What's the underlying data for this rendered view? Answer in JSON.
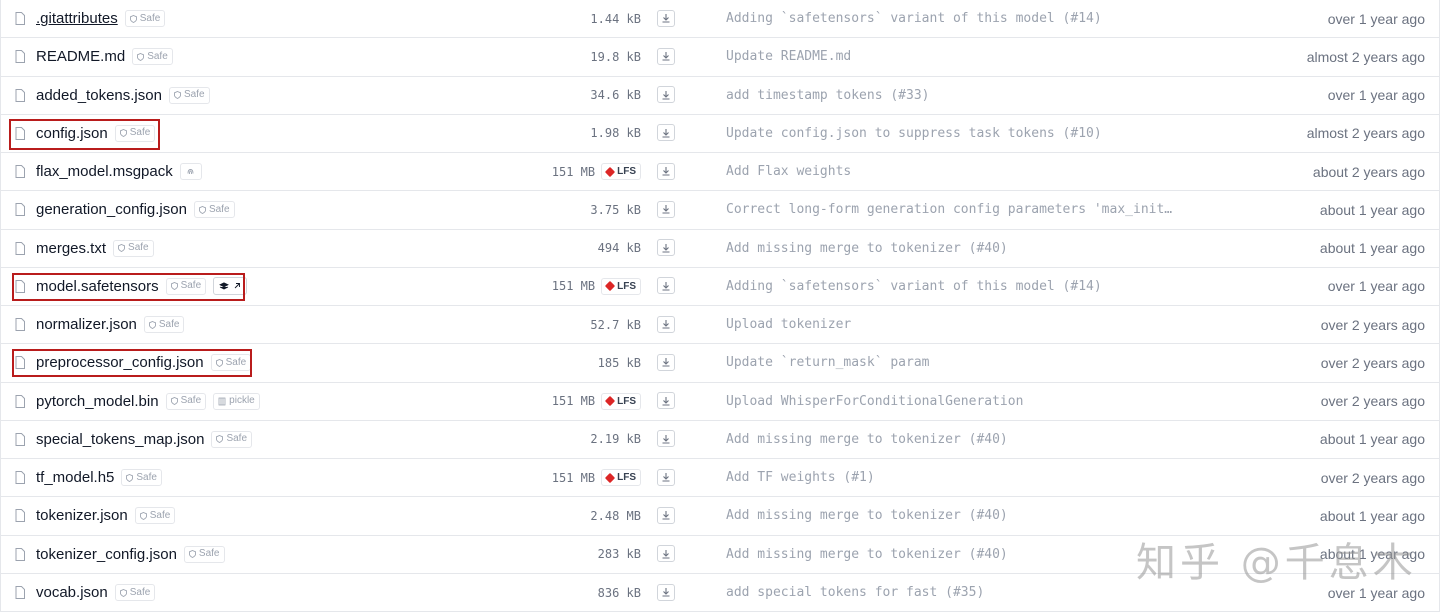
{
  "files": [
    {
      "name": ".gitattributes",
      "safe": "Safe",
      "size": "1.44 kB",
      "lfs": "",
      "commit": "Adding `safetensors` variant of this model (#14)",
      "date": "over 1 year ago"
    },
    {
      "name": "README.md",
      "safe": "Safe",
      "size": "19.8 kB",
      "lfs": "",
      "commit": "Update README.md",
      "date": "almost 2 years ago"
    },
    {
      "name": "added_tokens.json",
      "safe": "Safe",
      "size": "34.6 kB",
      "lfs": "",
      "commit": "add timestamp tokens (#33)",
      "date": "over 1 year ago"
    },
    {
      "name": "config.json",
      "safe": "Safe",
      "size": "1.98 kB",
      "lfs": "",
      "commit": "Update config.json to suppress task tokens (#10)",
      "date": "almost 2 years ago"
    },
    {
      "name": "flax_model.msgpack",
      "safe": "",
      "size": "151 MB",
      "lfs": "LFS",
      "commit": "Add Flax weights",
      "date": "about 2 years ago"
    },
    {
      "name": "generation_config.json",
      "safe": "Safe",
      "size": "3.75 kB",
      "lfs": "",
      "commit": "Correct long-form generation config parameters 'max_init…",
      "date": "about 1 year ago"
    },
    {
      "name": "merges.txt",
      "safe": "Safe",
      "size": "494 kB",
      "lfs": "",
      "commit": "Add missing merge to tokenizer (#40)",
      "date": "about 1 year ago"
    },
    {
      "name": "model.safetensors",
      "safe": "Safe",
      "size": "151 MB",
      "lfs": "LFS",
      "commit": "Adding `safetensors` variant of this model (#14)",
      "date": "over 1 year ago"
    },
    {
      "name": "normalizer.json",
      "safe": "Safe",
      "size": "52.7 kB",
      "lfs": "",
      "commit": "Upload tokenizer",
      "date": "over 2 years ago"
    },
    {
      "name": "preprocessor_config.json",
      "safe": "Safe",
      "size": "185 kB",
      "lfs": "",
      "commit": "Update `return_mask` param",
      "date": "over 2 years ago"
    },
    {
      "name": "pytorch_model.bin",
      "safe": "Safe",
      "pickle": "pickle",
      "size": "151 MB",
      "lfs": "LFS",
      "commit": "Upload WhisperForConditionalGeneration",
      "date": "over 2 years ago"
    },
    {
      "name": "special_tokens_map.json",
      "safe": "Safe",
      "size": "2.19 kB",
      "lfs": "",
      "commit": "Add missing merge to tokenizer (#40)",
      "date": "about 1 year ago"
    },
    {
      "name": "tf_model.h5",
      "safe": "Safe",
      "size": "151 MB",
      "lfs": "LFS",
      "commit": "Add TF weights (#1)",
      "date": "over 2 years ago"
    },
    {
      "name": "tokenizer.json",
      "safe": "Safe",
      "size": "2.48 MB",
      "lfs": "",
      "commit": "Add missing merge to tokenizer (#40)",
      "date": "about 1 year ago"
    },
    {
      "name": "tokenizer_config.json",
      "safe": "Safe",
      "size": "283 kB",
      "lfs": "",
      "commit": "Add missing merge to tokenizer (#40)",
      "date": "about 1 year ago"
    },
    {
      "name": "vocab.json",
      "safe": "Safe",
      "size": "836 kB",
      "lfs": "",
      "commit": "add special tokens for fast (#35)",
      "date": "over 1 year ago"
    }
  ],
  "watermark": "知乎 @千息木",
  "colors": {
    "highlight": "#b91c1c",
    "lfs_cube": "#dc2626",
    "border": "#e5e7eb"
  }
}
